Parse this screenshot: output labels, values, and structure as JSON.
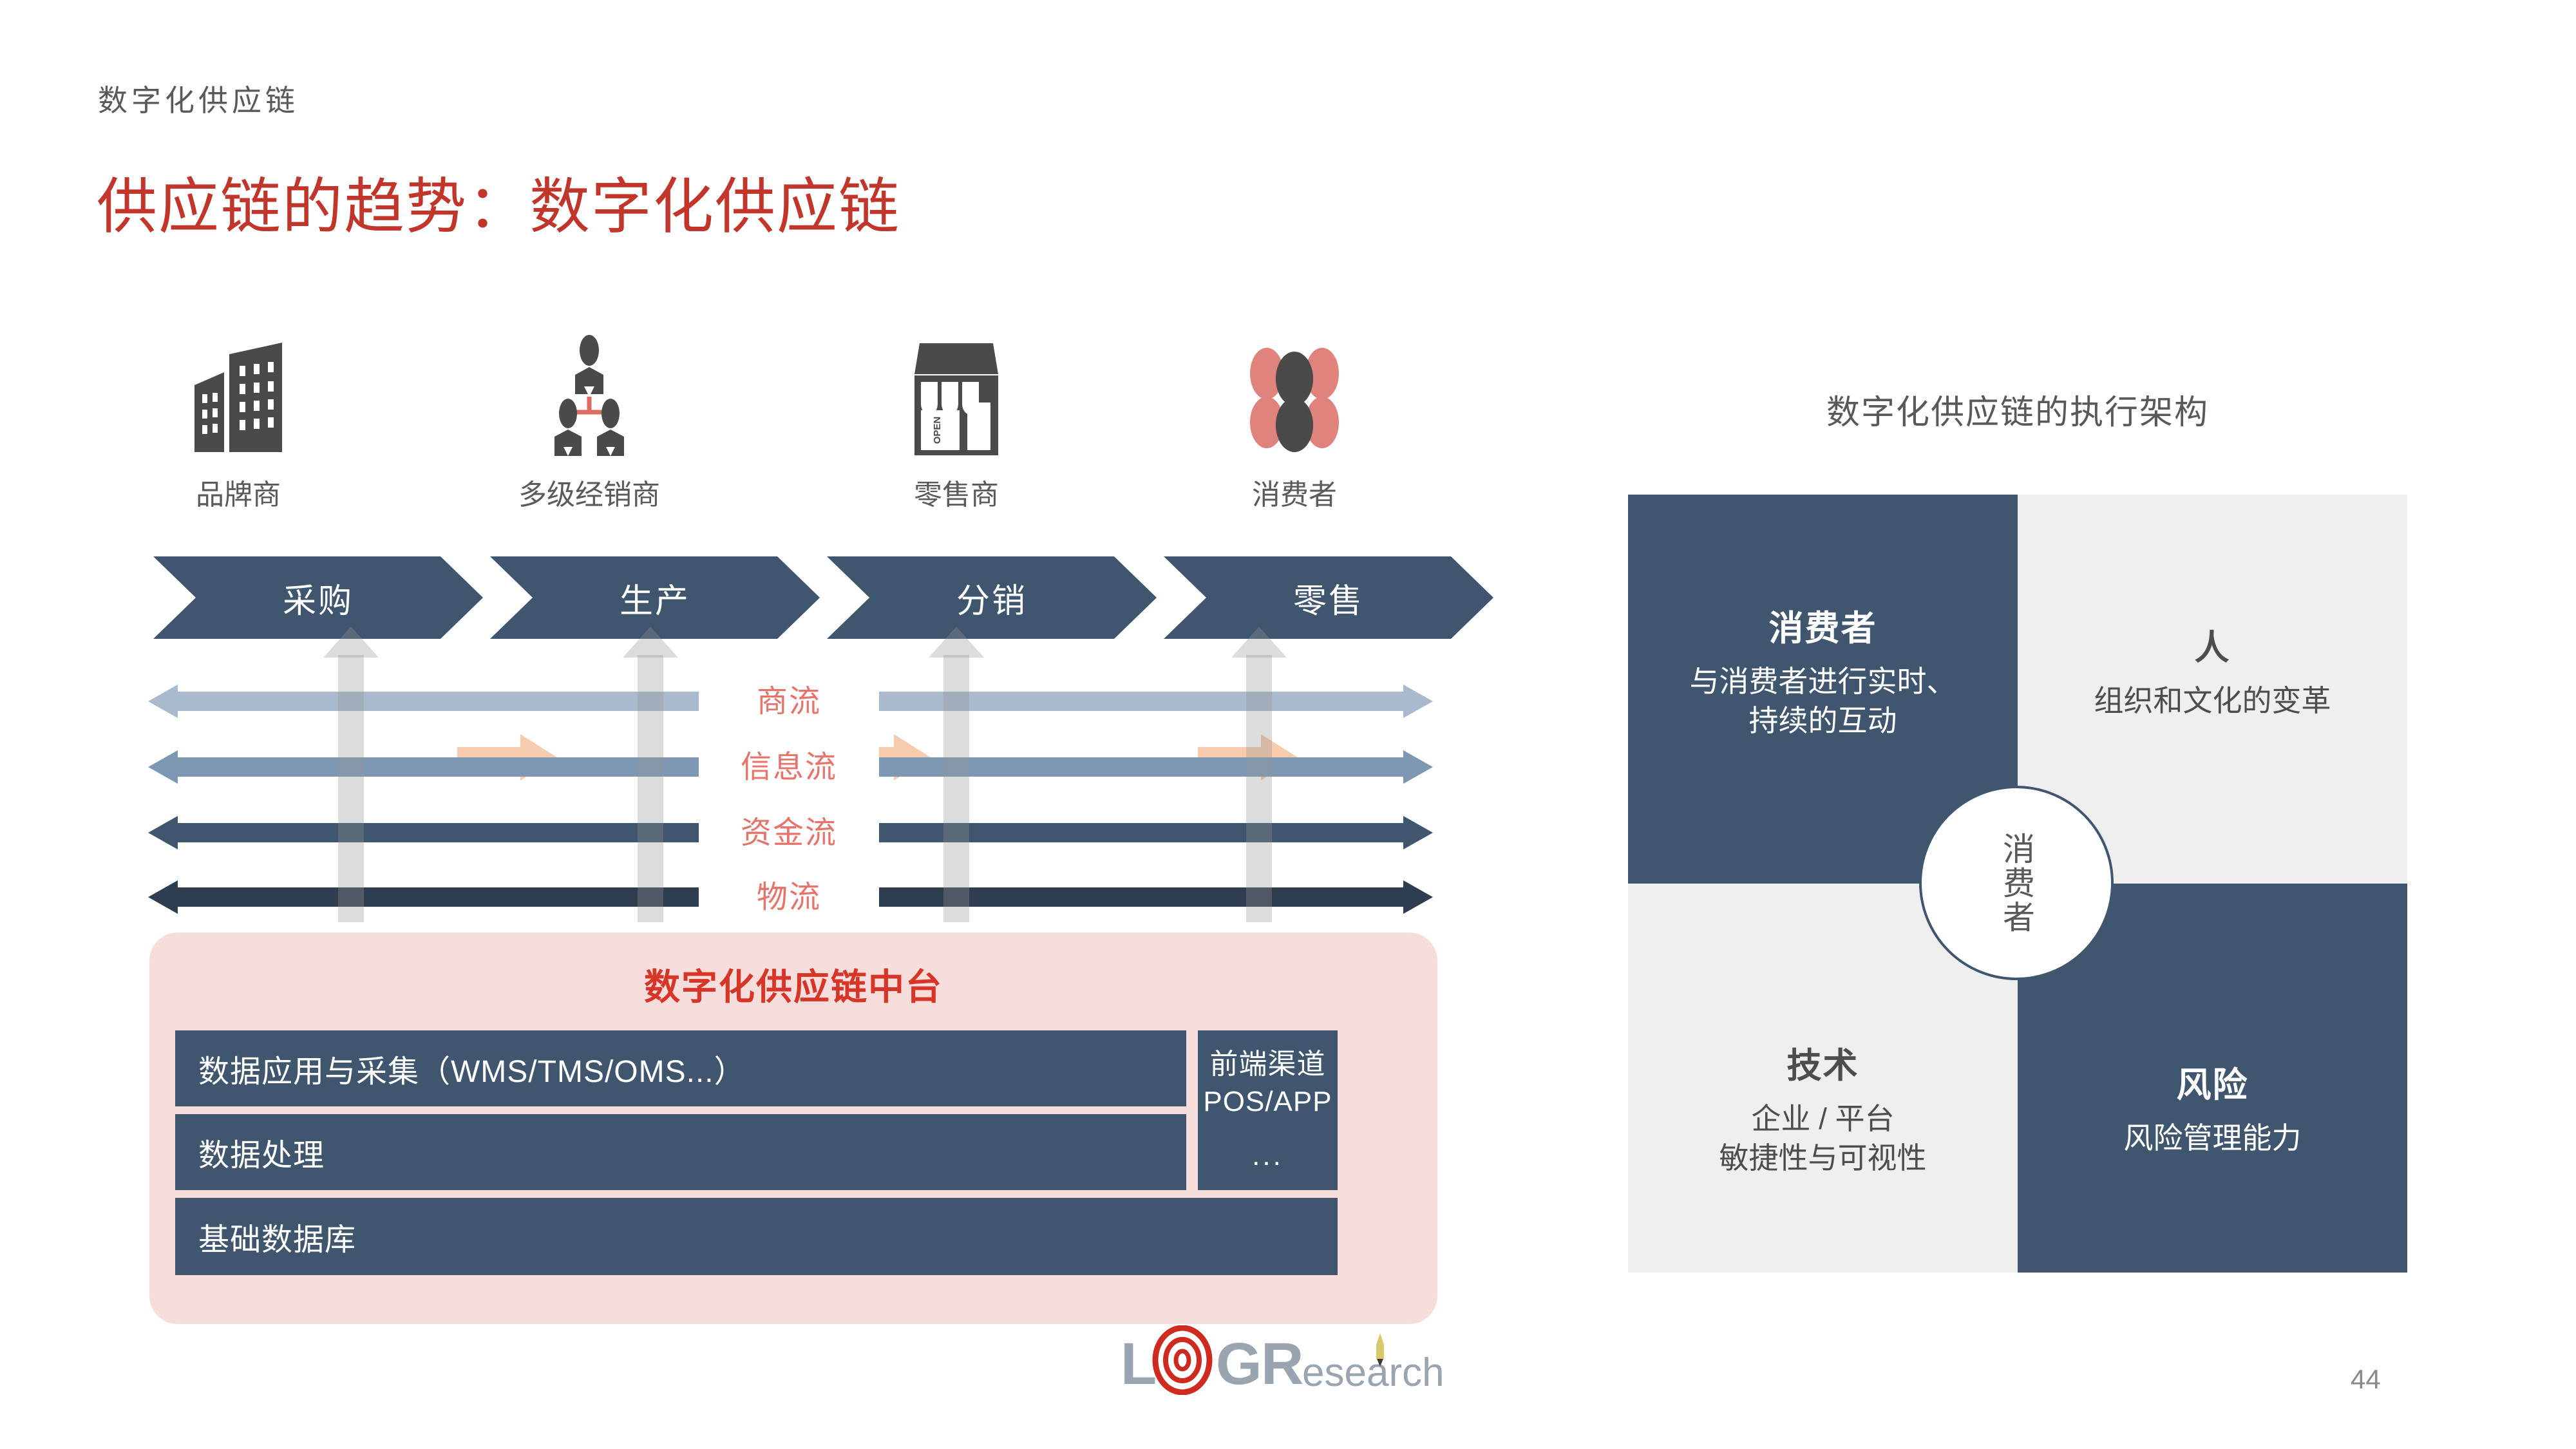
{
  "header": {
    "kicker": "数字化供应链",
    "title": "供应链的趋势：数字化供应链"
  },
  "supply_chain": {
    "actors": [
      {
        "label": "品牌商",
        "icon": "office-building-icon"
      },
      {
        "label": "多级经销商",
        "icon": "people-hierarchy-icon"
      },
      {
        "label": "零售商",
        "icon": "storefront-open-icon"
      },
      {
        "label": "消费者",
        "icon": "consumer-group-icon"
      }
    ],
    "connector_icon": "right-arrow-icon",
    "stages": [
      "采购",
      "生产",
      "分销",
      "零售"
    ],
    "flows": [
      {
        "label": "商流",
        "color": "#A9BACE"
      },
      {
        "label": "信息流",
        "color": "#7E98B3"
      },
      {
        "label": "资金流",
        "color": "#3F566E"
      },
      {
        "label": "物流",
        "color": "#2E3E50"
      }
    ],
    "vertical_arrow_icon": "up-arrow-icon"
  },
  "platform": {
    "title": "数字化供应链中台",
    "layers": [
      "数据应用与采集（WMS/TMS/OMS...）",
      "数据处理",
      "基础数据库"
    ],
    "front_channel": {
      "line1": "前端渠道",
      "line2": "POS/APP",
      "line3": "..."
    }
  },
  "architecture": {
    "title": "数字化供应链的执行架构",
    "center_label": "消费者",
    "quadrants": [
      {
        "heading": "消费者",
        "sub": "与消费者进行实时、\n持续的互动",
        "dark": true
      },
      {
        "heading": "人",
        "sub": "组织和文化的变革",
        "dark": false
      },
      {
        "heading": "技术",
        "sub": "企业 / 平台\n敏捷性与可视性",
        "dark": false
      },
      {
        "heading": "风险",
        "sub": "风险管理能力",
        "dark": true
      }
    ]
  },
  "logo": {
    "part1": "L",
    "part2": "G",
    "part3": "R",
    "part4": "esearch"
  },
  "footer": {
    "page_number": "44"
  },
  "colors": {
    "title_red": "#C1352B",
    "flow_label_red": "#E8736A",
    "dark_slate": "#3F566E",
    "pink_panel": "#F7DDDC",
    "light_gray_panel": "#EFEFEF",
    "arrow_peach": "#F7CBAE"
  }
}
